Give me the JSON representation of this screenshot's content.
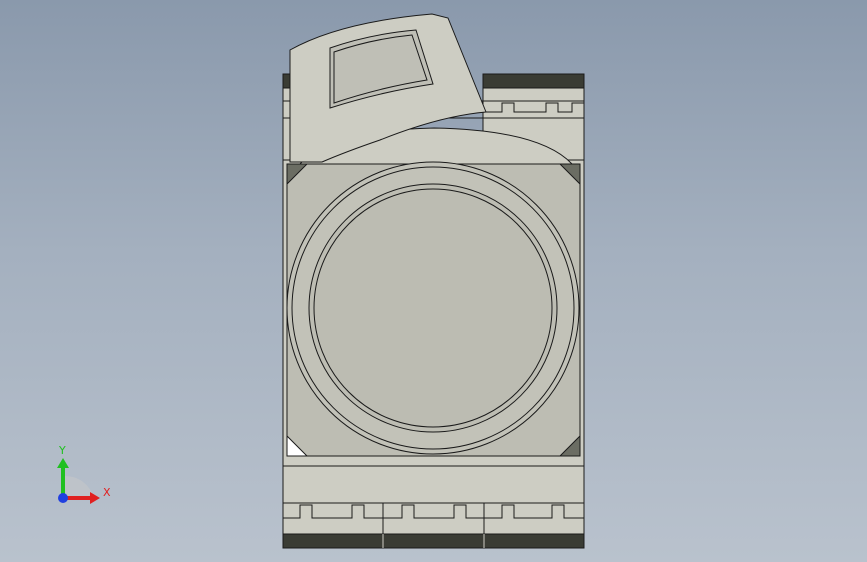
{
  "triad": {
    "x_label": "X",
    "y_label": "Y",
    "x_color": "#e02020",
    "y_color": "#20c020",
    "z_color": "#2040e0"
  },
  "model": {
    "body_color": "#cdcdc3",
    "face_color": "#bdbdb3",
    "dark_band_color": "#3a3c34",
    "outline_color": "#1a1a1a"
  }
}
